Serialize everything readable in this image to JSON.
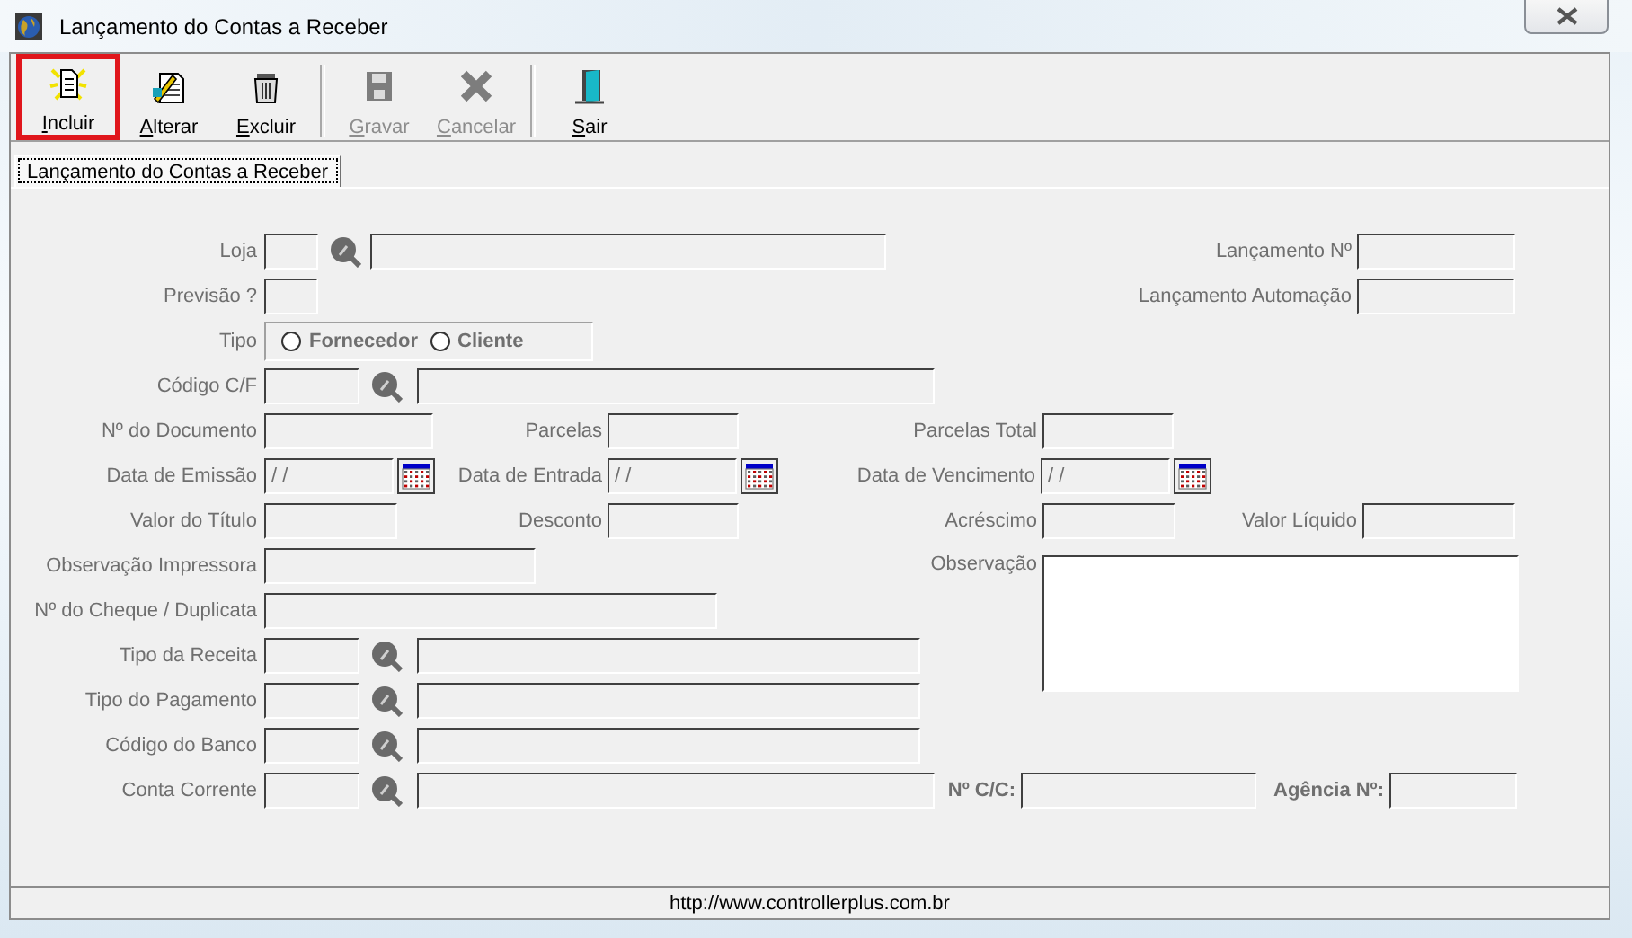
{
  "window": {
    "title": "Lançamento do Contas a Receber"
  },
  "toolbar": [
    {
      "label": "Incluir",
      "disabled": false,
      "highlighted": true
    },
    {
      "label": "Alterar",
      "disabled": false,
      "highlighted": false
    },
    {
      "label": "Excluir",
      "disabled": false,
      "highlighted": false
    },
    {
      "label": "Gravar",
      "disabled": true,
      "highlighted": false
    },
    {
      "label": "Cancelar",
      "disabled": true,
      "highlighted": false
    },
    {
      "label": "Sair",
      "disabled": false,
      "highlighted": false
    }
  ],
  "tab": {
    "label": "Lançamento do Contas a Receber",
    "selected": true
  },
  "form": {
    "loja": "Loja",
    "lancamento_no": "Lançamento Nº",
    "previsao": "Previsão ?",
    "lancamento_automacao": "Lançamento Automação",
    "tipo": {
      "label": "Tipo",
      "options": [
        {
          "label": "Fornecedor",
          "selected": false
        },
        {
          "label": "Cliente",
          "selected": false
        }
      ]
    },
    "codigo_cf": "Código C/F",
    "n_documento": "Nº do Documento",
    "parcelas": "Parcelas",
    "parcelas_total": "Parcelas Total",
    "data_emissao": {
      "label": "Data de Emissão",
      "value": "/ /"
    },
    "data_entrada": {
      "label": "Data de Entrada",
      "value": "/ /"
    },
    "data_vencimento": {
      "label": "Data de Vencimento",
      "value": "/ /"
    },
    "valor_titulo": "Valor do Título",
    "desconto": "Desconto",
    "acrescimo": "Acréscimo",
    "valor_liquido": "Valor Líquido",
    "observacao_impressora": "Observação Impressora",
    "n_cheque": "Nº do Cheque / Duplicata",
    "observacao": "Observação",
    "tipo_receita": "Tipo da Receita",
    "tipo_pagamento": "Tipo do Pagamento",
    "codigo_banco": "Código do Banco",
    "conta_corrente": "Conta Corrente",
    "n_cc": "Nº C/C:",
    "agencia": "Agência Nº:"
  },
  "status_bar": "http://www.controllerplus.com.br"
}
